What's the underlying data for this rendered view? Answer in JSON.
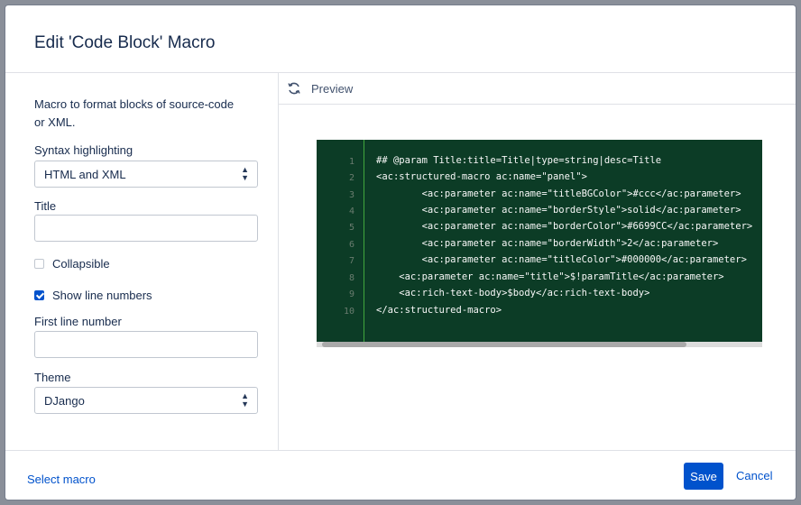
{
  "dialog": {
    "title": "Edit 'Code Block' Macro"
  },
  "form": {
    "description": "Macro to format blocks of source-code or XML.",
    "syntax_label": "Syntax highlighting",
    "syntax_value": "HTML and XML",
    "title_label": "Title",
    "title_value": "",
    "collapsible_label": "Collapsible",
    "collapsible_checked": false,
    "show_line_numbers_label": "Show line numbers",
    "show_line_numbers_checked": true,
    "first_line_label": "First line number",
    "first_line_value": "",
    "theme_label": "Theme",
    "theme_value": "DJango"
  },
  "preview": {
    "label": "Preview",
    "line_numbers": [
      "1",
      "2",
      "3",
      "4",
      "5",
      "6",
      "7",
      "8",
      "9",
      "10"
    ],
    "lines": [
      "## @param Title:title=Title|type=string|desc=Title",
      "<ac:structured-macro ac:name=\"panel\">",
      "        <ac:parameter ac:name=\"titleBGColor\">#ccc</ac:parameter>",
      "        <ac:parameter ac:name=\"borderStyle\">solid</ac:parameter>",
      "        <ac:parameter ac:name=\"borderColor\">#6699CC</ac:parameter>",
      "        <ac:parameter ac:name=\"borderWidth\">2</ac:parameter>",
      "        <ac:parameter ac:name=\"titleColor\">#000000</ac:parameter>",
      "    <ac:parameter ac:name=\"title\">$!paramTitle</ac:parameter>",
      "    <ac:rich-text-body>$body</ac:rich-text-body>",
      "</ac:structured-macro>"
    ]
  },
  "footer": {
    "select_macro": "Select macro",
    "save": "Save",
    "cancel": "Cancel"
  },
  "colors": {
    "primary": "#0052cc",
    "code_bg": "#0c3c26",
    "gutter_border": "#41a83e"
  },
  "icons": {
    "preview": "refresh-icon",
    "select": "sort-arrows-icon"
  }
}
